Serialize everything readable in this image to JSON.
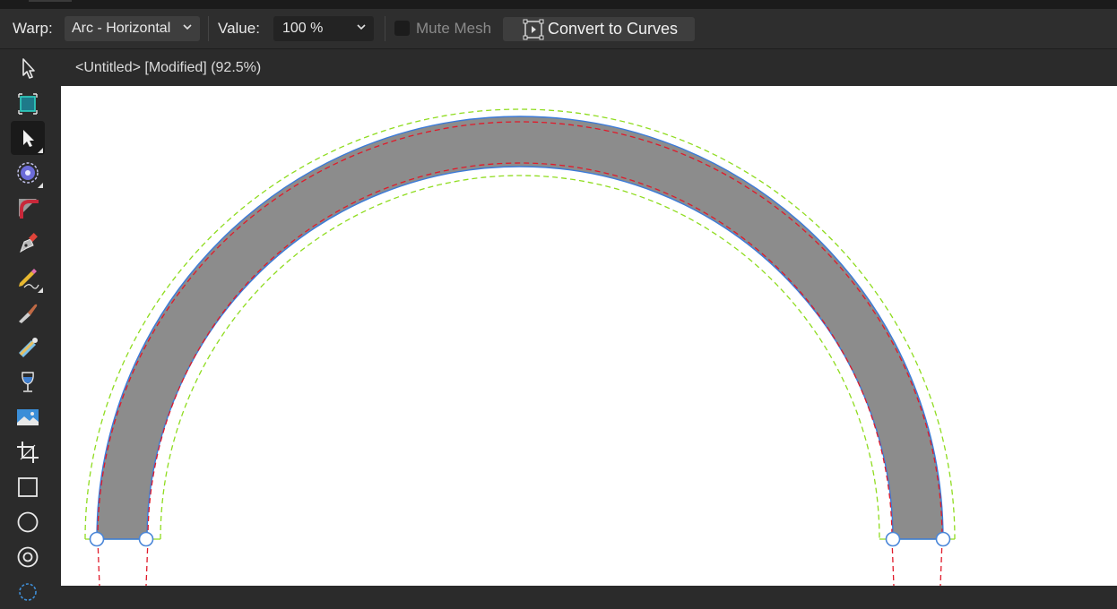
{
  "context_toolbar": {
    "warp_label": "Warp:",
    "warp_value": "Arc - Horizontal",
    "value_label": "Value:",
    "value_value": "100 %",
    "mute_mesh_label": "Mute Mesh",
    "mute_mesh_checked": false,
    "convert_button_label": "Convert to Curves"
  },
  "document": {
    "title": "<Untitled> [Modified] (92.5%)"
  },
  "tools": [
    {
      "name": "move-tool",
      "icon": "arrow-pointer-icon",
      "active": false
    },
    {
      "name": "artboard-tool",
      "icon": "artboard-icon",
      "active": false
    },
    {
      "name": "node-tool",
      "icon": "node-pointer-icon",
      "active": true
    },
    {
      "name": "point-transform-tool",
      "icon": "target-icon",
      "active": false
    },
    {
      "name": "corner-tool",
      "icon": "corner-icon",
      "active": false
    },
    {
      "name": "pen-tool",
      "icon": "pen-nib-icon",
      "active": false
    },
    {
      "name": "pencil-tool",
      "icon": "pencil-icon",
      "active": false
    },
    {
      "name": "vector-brush-tool",
      "icon": "brush-icon",
      "active": false
    },
    {
      "name": "fill-tool",
      "icon": "fill-icon",
      "active": false
    },
    {
      "name": "transparency-tool",
      "icon": "wine-glass-icon",
      "active": false
    },
    {
      "name": "place-image-tool",
      "icon": "image-icon",
      "active": false
    },
    {
      "name": "crop-tool",
      "icon": "crop-icon",
      "active": false
    },
    {
      "name": "rectangle-tool",
      "icon": "rectangle-icon",
      "active": false
    },
    {
      "name": "ellipse-tool",
      "icon": "circle-icon",
      "active": false
    },
    {
      "name": "donut-tool",
      "icon": "donut-icon",
      "active": false
    }
  ],
  "colors": {
    "arc_fill": "#8c8c8c",
    "arc_outline": "#3b7bd9",
    "guide_green": "#8fdc1f",
    "guide_red": "#e01a2a",
    "handle": "#4a86d8"
  }
}
